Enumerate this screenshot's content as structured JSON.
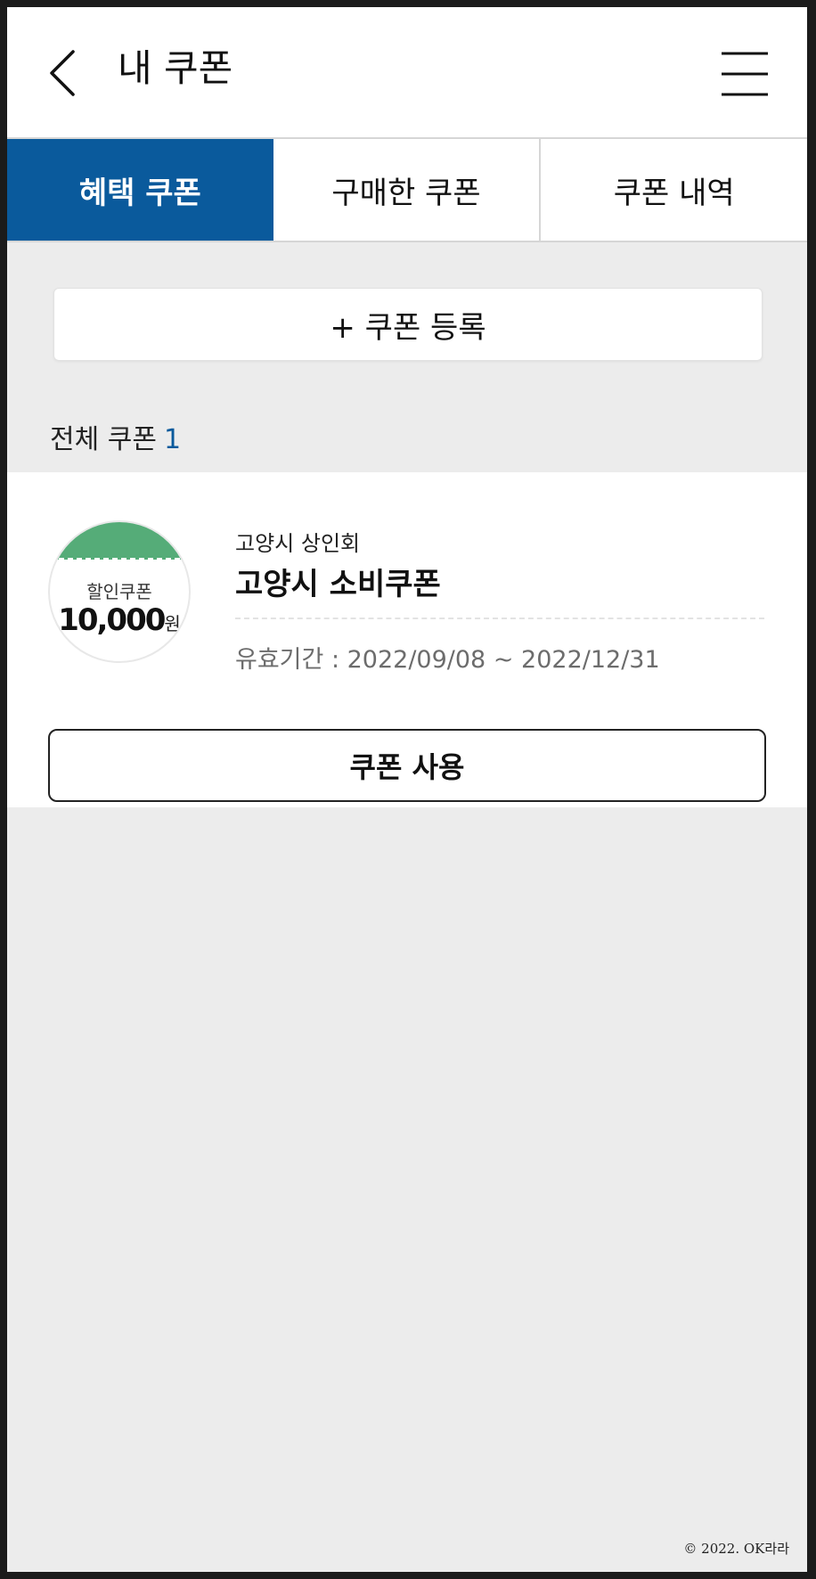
{
  "header": {
    "title": "내 쿠폰",
    "back_icon": "chevron-left-icon",
    "menu_icon": "hamburger-menu-icon"
  },
  "tabs": [
    {
      "label": "혜택 쿠폰",
      "active": true
    },
    {
      "label": "구매한 쿠폰",
      "active": false
    },
    {
      "label": "쿠폰 내역",
      "active": false
    }
  ],
  "register": {
    "label": "+ 쿠폰 등록"
  },
  "summary": {
    "label": "전체 쿠폰",
    "count": "1"
  },
  "coupon": {
    "badge_label": "할인쿠폰",
    "amount": "10,000",
    "unit": "원",
    "issuer": "고양시 상인회",
    "name": "고양시 소비쿠폰",
    "validity": "유효기간 : 2022/09/08 ~ 2022/12/31",
    "use_label": "쿠폰 사용"
  },
  "footer": {
    "copyright": "© 2022. OK라라"
  },
  "colors": {
    "accent": "#0a5a9c",
    "badge_green": "#55ac78",
    "background": "#ececec"
  }
}
